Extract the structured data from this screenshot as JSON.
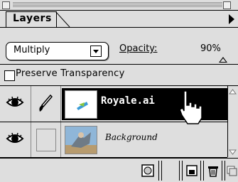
{
  "palette": {
    "tab_label": "Layers",
    "blend_mode": "Multiply",
    "opacity_label": "Opacity:",
    "opacity_value": "90%",
    "preserve_transparency_label": "Preserve Transparency",
    "preserve_transparency_checked": false
  },
  "layers": [
    {
      "name": "Royale.ai",
      "visible": true,
      "selected": true,
      "editable": true
    },
    {
      "name": "Background",
      "visible": true,
      "selected": false,
      "editable": false
    }
  ],
  "icons": {
    "eye": "eye-icon",
    "brush": "paintbrush-icon",
    "new_layer": "new-layer-icon",
    "trash": "trash-icon",
    "mask": "layer-mask-icon",
    "menu": "palette-menu-arrow-icon",
    "cursor": "hand-cursor-icon"
  },
  "colors": {
    "panel_bg": "#dedede",
    "selected_row": "#000000",
    "selected_text": "#ffffff"
  }
}
